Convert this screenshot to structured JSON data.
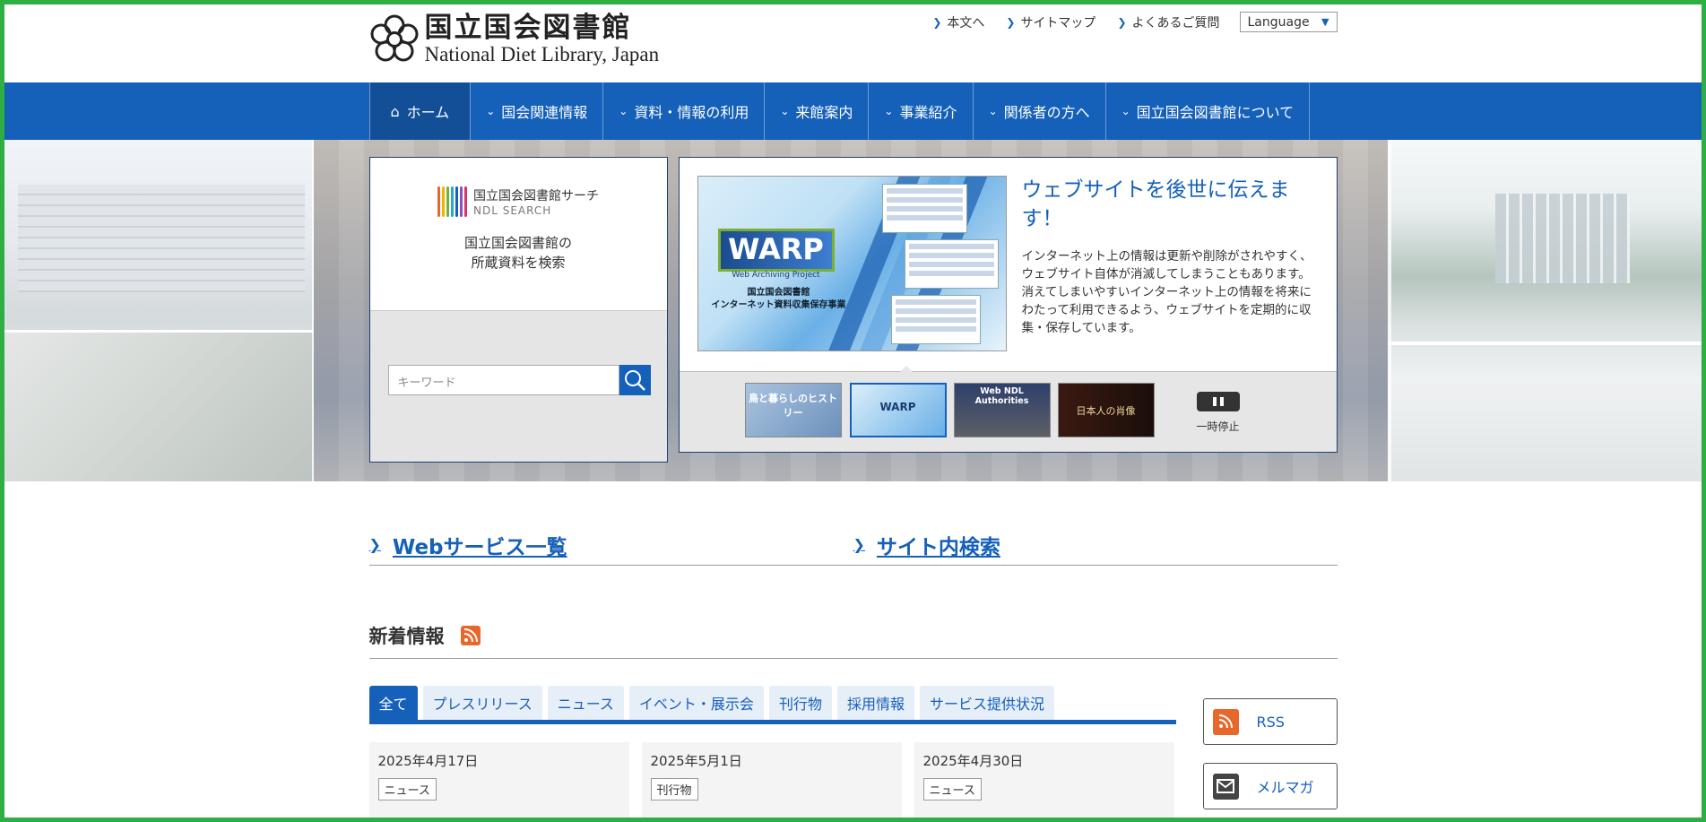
{
  "header": {
    "logo_jp": "国立国会図書館",
    "logo_en": "National Diet Library, Japan",
    "util_links": [
      "本文へ",
      "サイトマップ",
      "よくあるご質問"
    ],
    "language_select": "Language"
  },
  "nav": {
    "items": [
      {
        "label": "ホーム",
        "icon": "home-icon",
        "active": true
      },
      {
        "label": "国会関連情報",
        "icon": "chevron-down-icon"
      },
      {
        "label": "資料・情報の利用",
        "icon": "chevron-down-icon"
      },
      {
        "label": "来館案内",
        "icon": "chevron-down-icon"
      },
      {
        "label": "事業紹介",
        "icon": "chevron-down-icon"
      },
      {
        "label": "関係者の方へ",
        "icon": "chevron-down-icon"
      },
      {
        "label": "国立国会図書館について",
        "icon": "chevron-down-icon"
      }
    ]
  },
  "search": {
    "brand_jp": "国立国会図書館サーチ",
    "brand_en": "NDL SEARCH",
    "desc_line1": "国立国会図書館の",
    "desc_line2": "所蔵資料を検索",
    "placeholder": "キーワード"
  },
  "carousel": {
    "image_title": "WARP",
    "image_subtitle": "Web Archiving Project",
    "image_caption_1": "国立国会図書館",
    "image_caption_2": "インターネット資料収集保存事業",
    "title": "ウェブサイトを後世に伝えます！",
    "text": "インターネット上の情報は更新や削除がされやすく、ウェブサイト自体が消滅してしまうこともあります。消えてしまいやすいインターネット上の情報を将来にわたって利用できるよう、ウェブサイトを定期的に収集・保存しています。",
    "thumbs": [
      "鳥と暮らしのヒストリー",
      "WARP",
      "Web NDL Authorities",
      "日本人の肖像"
    ],
    "pause_label": "一時停止"
  },
  "quick_links": [
    "Webサービス一覧",
    "サイト内検索"
  ],
  "news": {
    "title": "新着情報",
    "tabs": [
      "全て",
      "プレスリリース",
      "ニュース",
      "イベント・展示会",
      "刊行物",
      "採用情報",
      "サービス提供状況"
    ],
    "cards": [
      {
        "date": "2025年4月17日",
        "category": "ニュース"
      },
      {
        "date": "2025年5月1日",
        "category": "刊行物"
      },
      {
        "date": "2025年4月30日",
        "category": "ニュース"
      }
    ]
  },
  "side": {
    "rss": "RSS",
    "mail": "メルマガ"
  },
  "colors": {
    "primary": "#1560b8",
    "frame": "#2fae44",
    "rss": "#e8672a"
  }
}
